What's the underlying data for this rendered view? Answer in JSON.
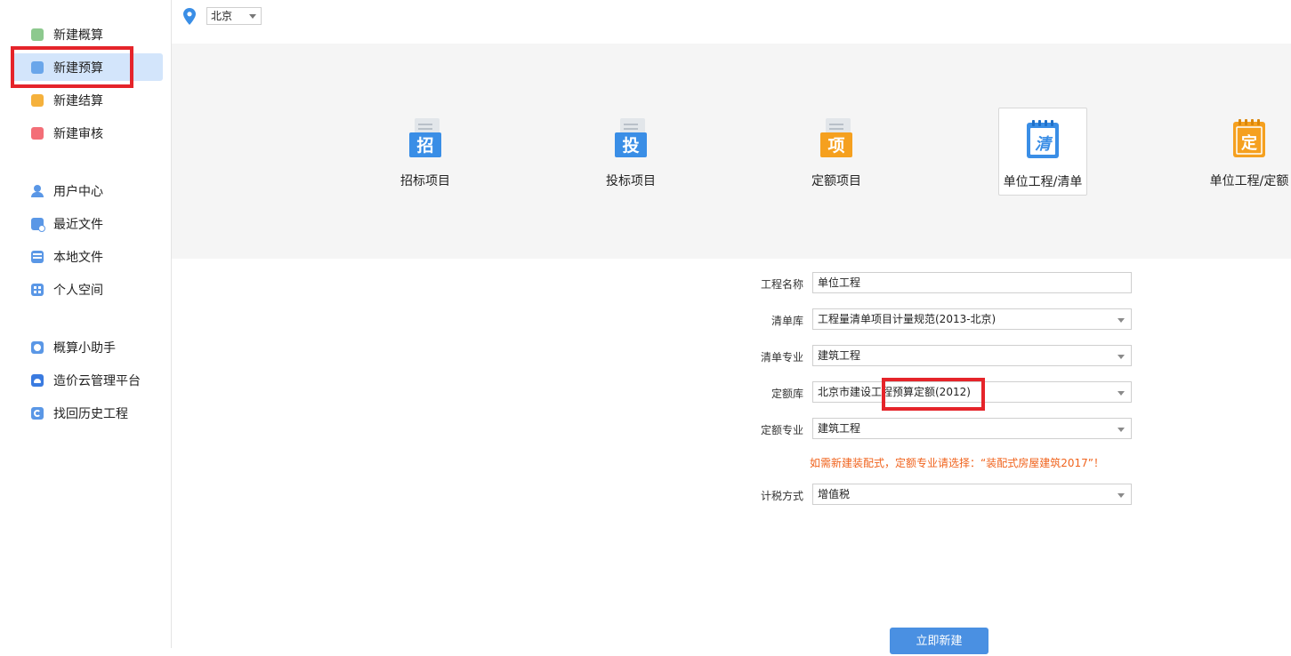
{
  "sidebar": {
    "groups": [
      [
        {
          "label": "新建概算",
          "icon": "estimate-icon",
          "active": false
        },
        {
          "label": "新建预算",
          "icon": "budget-icon",
          "active": true
        },
        {
          "label": "新建结算",
          "icon": "settlement-icon",
          "active": false
        },
        {
          "label": "新建审核",
          "icon": "audit-icon",
          "active": false
        }
      ],
      [
        {
          "label": "用户中心",
          "icon": "user-icon"
        },
        {
          "label": "最近文件",
          "icon": "recent-files-icon"
        },
        {
          "label": "本地文件",
          "icon": "local-files-icon"
        },
        {
          "label": "个人空间",
          "icon": "personal-space-icon"
        }
      ],
      [
        {
          "label": "概算小助手",
          "icon": "assistant-icon"
        },
        {
          "label": "造价云管理平台",
          "icon": "cloud-platform-icon"
        },
        {
          "label": "找回历史工程",
          "icon": "history-icon"
        }
      ]
    ]
  },
  "location": {
    "city": "北京",
    "icon": "location-pin-icon"
  },
  "project_types": [
    {
      "glyph": "招",
      "label": "招标项目",
      "color": "#3a8ee6",
      "selected": false
    },
    {
      "glyph": "投",
      "label": "投标项目",
      "color": "#3a8ee6",
      "selected": false
    },
    {
      "glyph": "项",
      "label": "定额项目",
      "color": "#f5a01f",
      "selected": false
    },
    {
      "glyph": "清",
      "label": "单位工程/清单",
      "color": "#3a8ee6",
      "selected": true
    },
    {
      "glyph": "定",
      "label": "单位工程/定额",
      "color": "#f5a01f",
      "selected": false
    }
  ],
  "form": {
    "project_name": {
      "label": "工程名称",
      "value": "单位工程"
    },
    "bill_library": {
      "label": "清单库",
      "value": "工程量清单项目计量规范(2013-北京)"
    },
    "bill_specialty": {
      "label": "清单专业",
      "value": "建筑工程"
    },
    "quota_library": {
      "label": "定额库",
      "value": "北京市建设工程预算定额(2012)"
    },
    "quota_specialty": {
      "label": "定额专业",
      "value": "建筑工程"
    },
    "hint": "如需新建装配式，定额专业请选择：“装配式房屋建筑2017”！",
    "tax_method": {
      "label": "计税方式",
      "value": "增值税"
    }
  },
  "create_button": "立即新建",
  "colors": {
    "accent": "#4a90e2",
    "highlight": "#e5242a",
    "hint": "#f0631d"
  }
}
